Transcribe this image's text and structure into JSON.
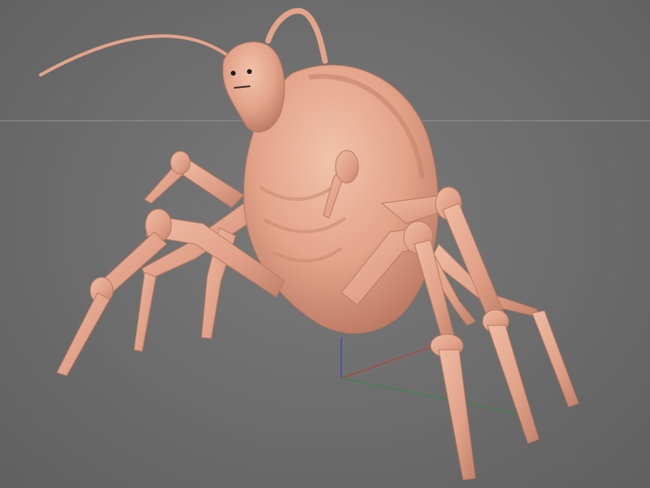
{
  "viewport": {
    "background_color": "#6b6b6b",
    "horizon_color": "#8e8e8e"
  },
  "model": {
    "subject": "creature-sculpt",
    "skin_color": "#e3a48a",
    "skin_shadow_color": "#b9775f",
    "skin_highlight_color": "#f2c2ab"
  },
  "gizmo": {
    "x_axis_color": "#c0392b",
    "y_axis_color": "#2e8b3e",
    "z_axis_color": "#2b3fbf"
  }
}
